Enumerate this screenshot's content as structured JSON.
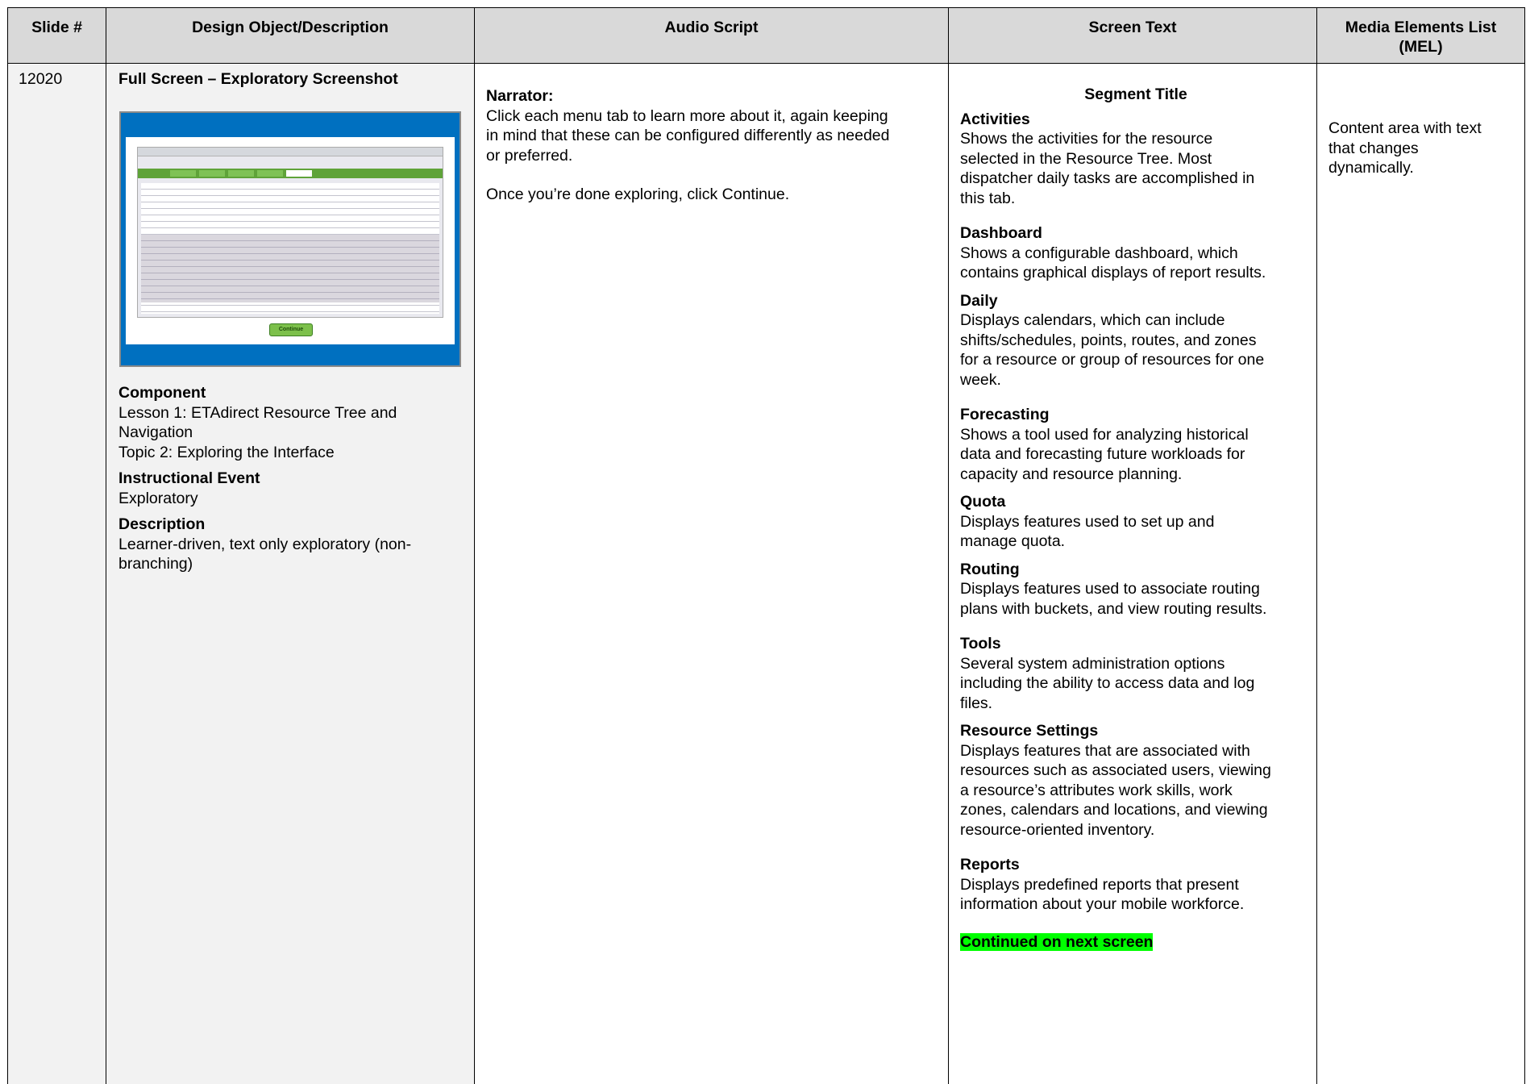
{
  "header": {
    "slide": "Slide #",
    "design": "Design Object/Description",
    "audio": "Audio Script",
    "screen": "Screen Text",
    "media_line1": "Media Elements List",
    "media_line2": "(MEL)"
  },
  "row": {
    "slide_number": "12020",
    "design": {
      "title": "Full Screen – Exploratory Screenshot",
      "thumbnail_button": "Continue",
      "component_label": "Component",
      "component_line1": "Lesson 1: ETAdirect Resource Tree and",
      "component_line2": "Navigation",
      "component_line3": "Topic 2: Exploring the Interface",
      "event_label": "Instructional Event",
      "event_value": "Exploratory",
      "description_label": "Description",
      "description_line1": "Learner-driven, text only exploratory (non-",
      "description_line2": "branching)"
    },
    "audio": {
      "speaker": "Narrator:",
      "line1": "Click each menu tab to learn more about it, again keeping",
      "line2": "in mind that these can be configured differently as needed",
      "line3": "or preferred.",
      "line4": "Once you’re done exploring, click Continue."
    },
    "screen": {
      "segment_title": "Segment Title",
      "items": [
        {
          "title": "Activities",
          "lines": [
            "Shows the activities for the resource",
            "selected in the Resource Tree.  Most",
            "dispatcher daily tasks are accomplished in",
            "this tab."
          ]
        },
        {
          "title": "Dashboard",
          "lines": [
            "Shows a configurable dashboard, which",
            "contains graphical displays of report results."
          ]
        },
        {
          "title": "Daily",
          "lines": [
            "Displays calendars, which can include",
            "shifts/schedules, points, routes, and zones",
            "for a resource or group of resources for one",
            "week."
          ]
        },
        {
          "title": "Forecasting",
          "lines": [
            "Shows a tool used for analyzing historical",
            "data and forecasting future workloads for",
            "capacity and resource planning."
          ]
        },
        {
          "title": "Quota",
          "lines": [
            "Displays features used to set up and",
            "manage quota."
          ]
        },
        {
          "title": "Routing",
          "lines": [
            "Displays features used to associate routing",
            "plans with buckets, and view routing results."
          ]
        },
        {
          "title": "Tools",
          "lines": [
            "Several system administration options",
            "including the ability to access data and log",
            "files."
          ]
        },
        {
          "title": "Resource Settings",
          "lines": [
            "Displays features that are associated with",
            "resources such as associated users, viewing",
            "a resource’s attributes work skills, work",
            "zones, calendars and locations, and viewing",
            "resource-oriented inventory."
          ]
        },
        {
          "title": "Reports",
          "lines": [
            "Displays predefined reports that present",
            "information about your mobile workforce."
          ]
        }
      ],
      "continued": "Continued on next screen"
    },
    "media": {
      "line1": "Content area with text",
      "line2": "that changes",
      "line3": "dynamically."
    }
  }
}
